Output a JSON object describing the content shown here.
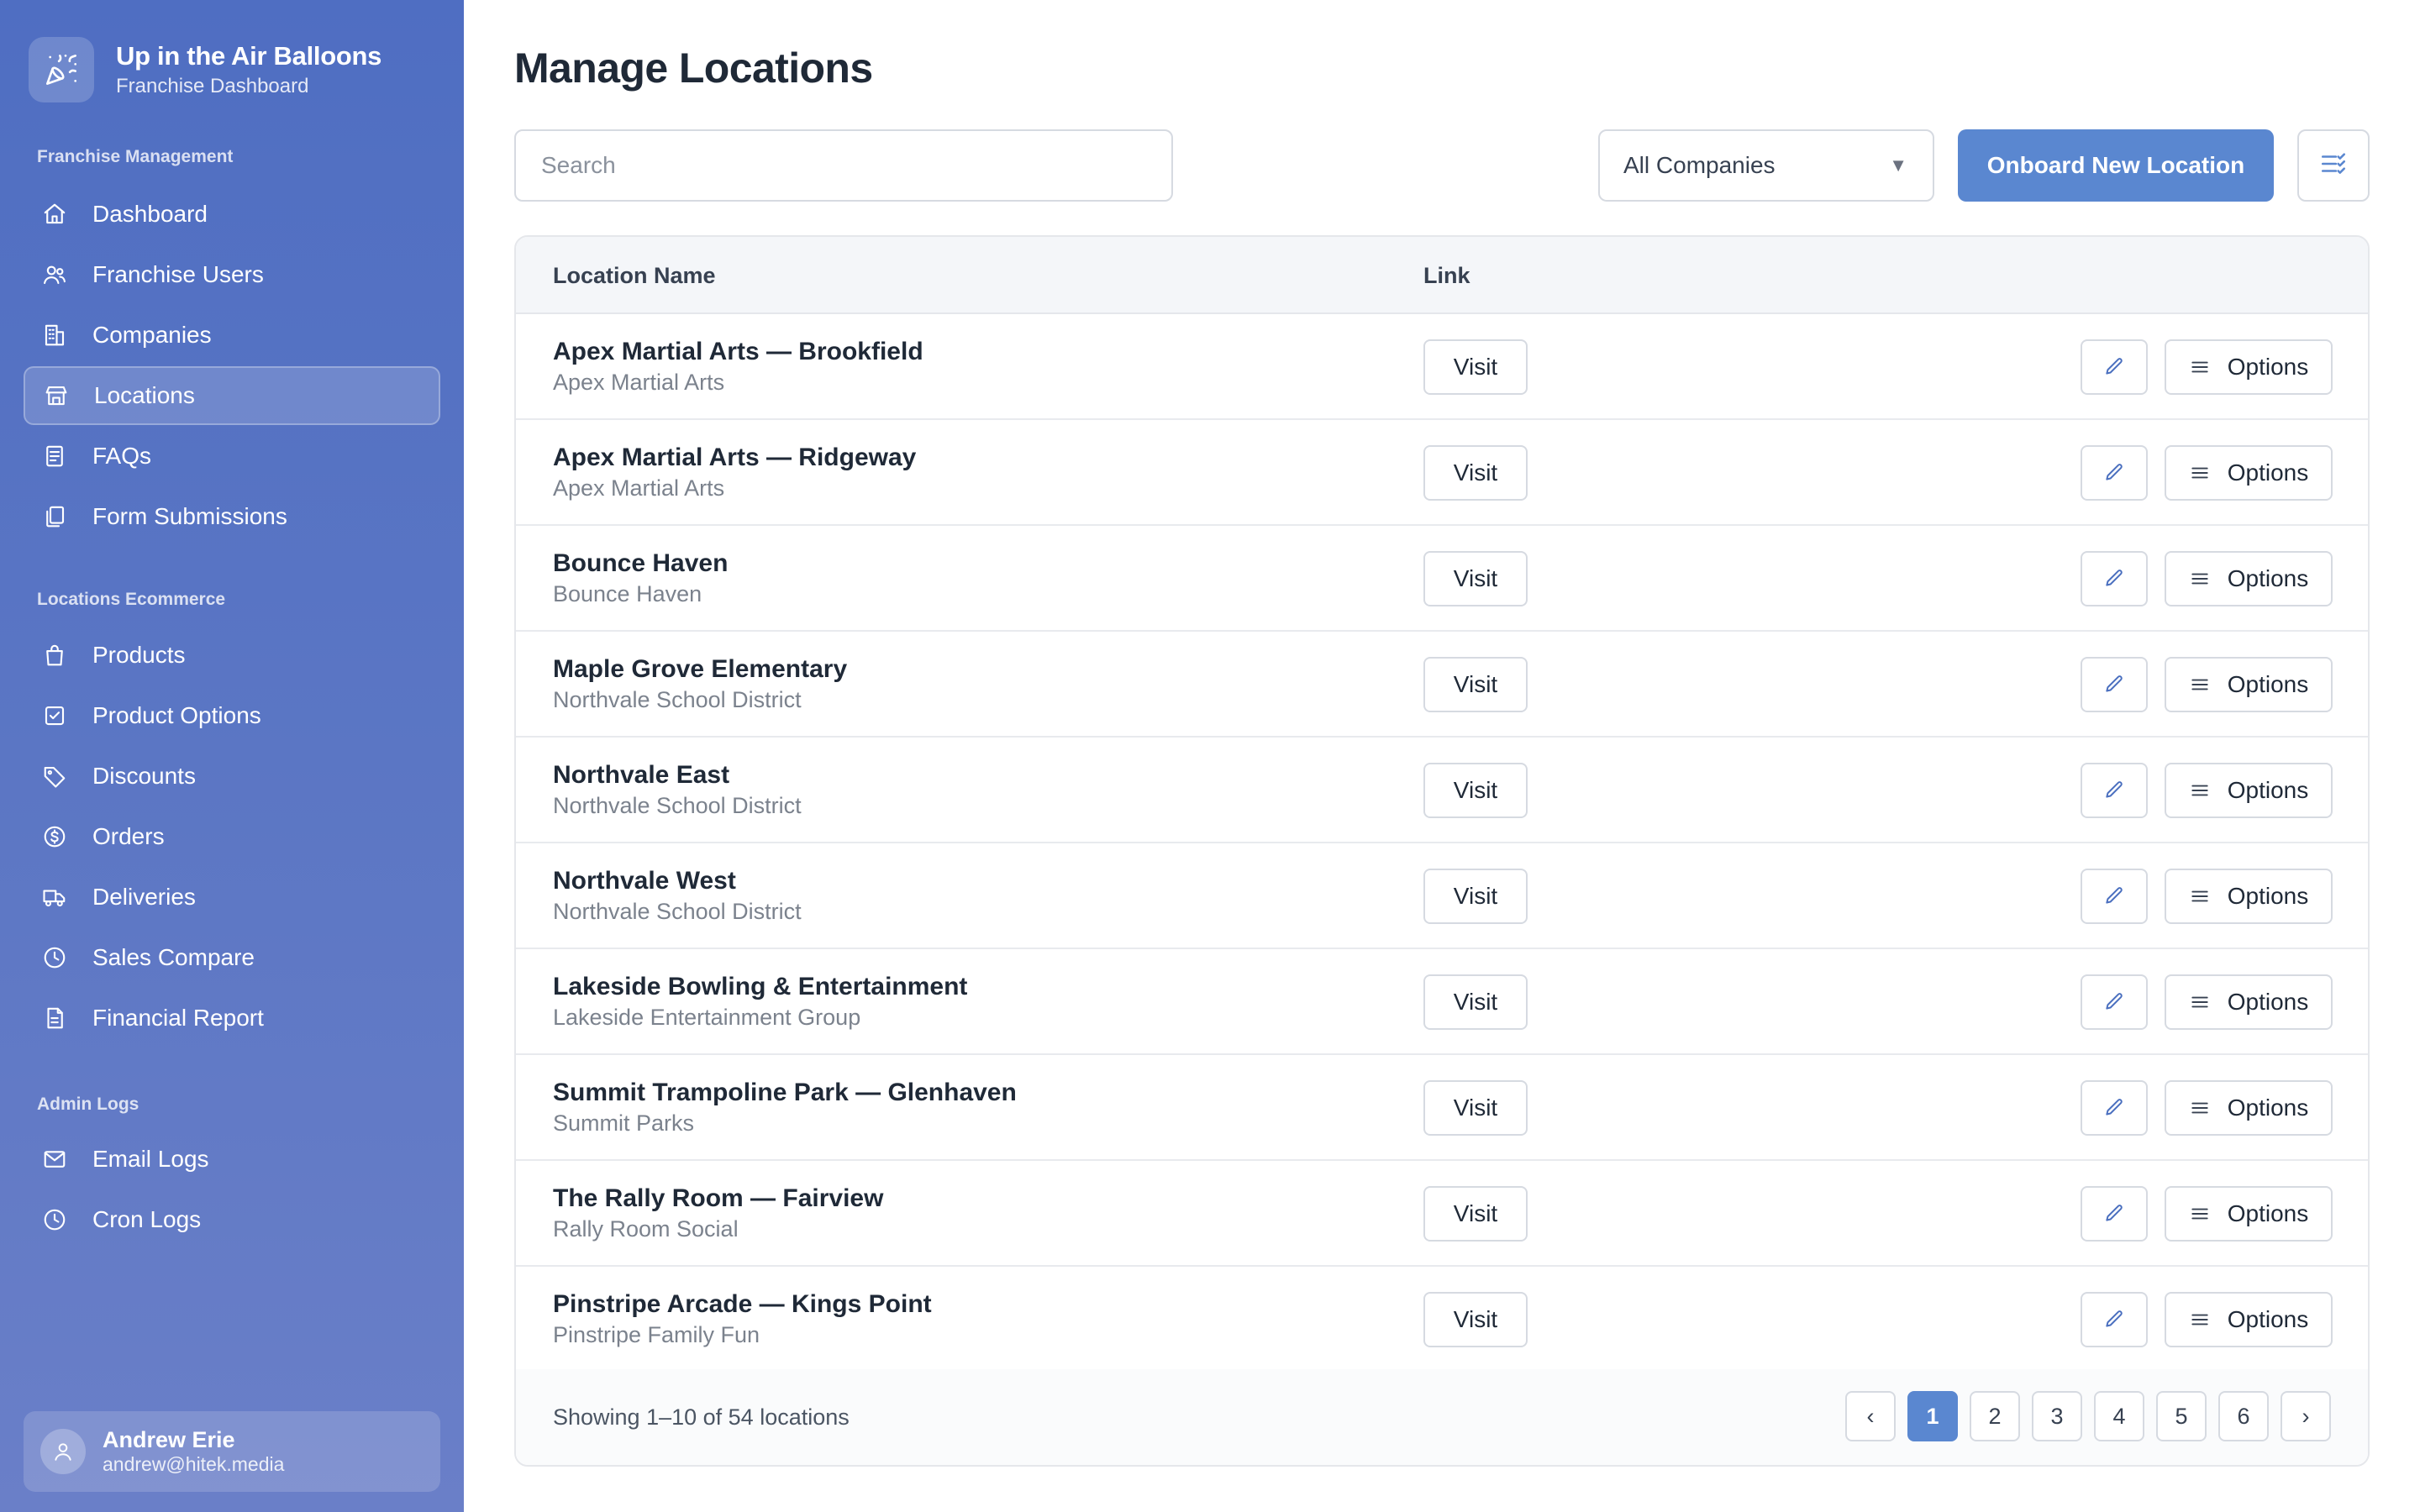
{
  "brand": {
    "title": "Up in the Air Balloons",
    "subtitle": "Franchise Dashboard"
  },
  "sidebar": {
    "sections": [
      {
        "label": "Franchise Management",
        "items": [
          {
            "label": "Dashboard",
            "icon": "home-icon"
          },
          {
            "label": "Franchise Users",
            "icon": "users-icon"
          },
          {
            "label": "Companies",
            "icon": "building-icon"
          },
          {
            "label": "Locations",
            "icon": "store-icon",
            "active": true
          },
          {
            "label": "FAQs",
            "icon": "document-icon"
          },
          {
            "label": "Form Submissions",
            "icon": "copy-icon"
          }
        ]
      },
      {
        "label": "Locations Ecommerce",
        "items": [
          {
            "label": "Products",
            "icon": "bag-icon"
          },
          {
            "label": "Product Options",
            "icon": "checklist-icon"
          },
          {
            "label": "Discounts",
            "icon": "tag-icon"
          },
          {
            "label": "Orders",
            "icon": "dollar-circle-icon"
          },
          {
            "label": "Deliveries",
            "icon": "truck-icon"
          },
          {
            "label": "Sales Compare",
            "icon": "clock-icon"
          },
          {
            "label": "Financial Report",
            "icon": "report-icon"
          }
        ]
      },
      {
        "label": "Admin Logs",
        "items": [
          {
            "label": "Email Logs",
            "icon": "mail-icon"
          },
          {
            "label": "Cron Logs",
            "icon": "clock-icon"
          }
        ]
      }
    ]
  },
  "user": {
    "name": "Andrew Erie",
    "email": "andrew@hitek.media"
  },
  "main": {
    "title": "Manage Locations",
    "search_placeholder": "Search",
    "company_filter": "All Companies",
    "onboard_label": "Onboard New Location",
    "columns": [
      "Location Name",
      "Link"
    ],
    "visit_label": "Visit",
    "options_label": "Options",
    "rows": [
      {
        "name": "Apex Martial Arts — Brookfield",
        "company": "Apex Martial Arts"
      },
      {
        "name": "Apex Martial Arts — Ridgeway",
        "company": "Apex Martial Arts"
      },
      {
        "name": "Bounce Haven",
        "company": "Bounce Haven"
      },
      {
        "name": "Maple Grove Elementary",
        "company": "Northvale School District"
      },
      {
        "name": "Northvale East",
        "company": "Northvale School District"
      },
      {
        "name": "Northvale West",
        "company": "Northvale School District"
      },
      {
        "name": "Lakeside Bowling & Entertainment",
        "company": "Lakeside Entertainment Group"
      },
      {
        "name": "Summit Trampoline Park — Glenhaven",
        "company": "Summit Parks"
      },
      {
        "name": "The Rally Room — Fairview",
        "company": "Rally Room Social"
      },
      {
        "name": "Pinstripe Arcade — Kings Point",
        "company": "Pinstripe Family Fun"
      }
    ],
    "footer": {
      "showing": "Showing 1–10 of 54 locations",
      "prev": "‹",
      "next": "›",
      "pages": [
        "1",
        "2",
        "3",
        "4",
        "5",
        "6"
      ],
      "current_page": "1"
    }
  },
  "colors": {
    "accent": "#5a87d0",
    "sidebar_top": "#4f6ec2",
    "sidebar_bottom": "#6a7fc8"
  }
}
